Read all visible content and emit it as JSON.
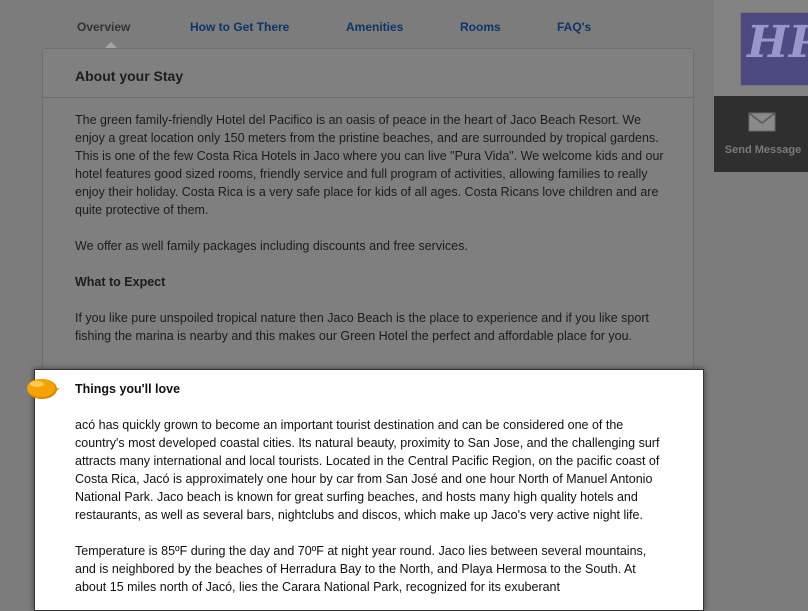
{
  "nav": {
    "tabs": [
      {
        "label": "Overview",
        "active": true
      },
      {
        "label": "How to Get There",
        "active": false
      },
      {
        "label": "Amenities",
        "active": false
      },
      {
        "label": "Rooms",
        "active": false
      },
      {
        "label": "FAQ's",
        "active": false
      }
    ]
  },
  "panel": {
    "title": "About your Stay",
    "intro": "The green family-friendly Hotel del Pacifico is an oasis of peace in the heart of Jaco Beach Resort. We enjoy a great location only 150 meters from the pristine beaches, and are surrounded by tropical gardens. This is one of the few Costa Rica Hotels in Jaco where you can live \"Pura Vida\". We welcome kids and our hotel features good sized rooms, friendly service and full program of activities, allowing families to really enjoy their holiday. Costa Rica is a very safe place for kids of all ages. Costa Ricans love children and are quite protective of them.",
    "packages": "We offer as well family packages including discounts and free services.",
    "expect_heading": "What to Expect",
    "expect_text": "If you like pure unspoiled tropical nature then Jaco Beach is the place to experience and if you like sport fishing the marina is nearby and this makes our Green Hotel the perfect and affordable place for you."
  },
  "highlight": {
    "heading": "Things you'll love",
    "para1": "acó has quickly grown to become an important tourist destination and can be considered one of the country's most developed coastal cities. Its natural beauty, proximity to San Jose, and the challenging surf attracts many international and local tourists. Located in the Central Pacific Region, on the pacific coast of Costa Rica, Jacó is approximately one hour by car from San José and one hour North of Manuel Antonio National Park. Jaco beach is known for great surfing beaches, and hosts many high quality hotels and restaurants, as well as several bars, nightclubs and discos, which make up Jaco's very active night life.",
    "para2": "Temperature is 85ºF during the day and 70ºF at night year round. Jaco lies between several mountains, and is neighbored by the beaches of Herradura Bay to the North, and Playa Hermosa to the South. At about 15 miles north of Jacó, lies the Carara National Park, recognized for its exuberant"
  },
  "sidebar": {
    "logo_text": "HP",
    "send_message": "Send Message",
    "icons": {
      "envelope": "envelope-icon",
      "pointer": "callout-pointer-icon"
    }
  },
  "colors": {
    "nav_link": "#0e3569",
    "overlay": "#7c7c7c",
    "pointer": "#f5a300",
    "logo_bg": "#4d4a82"
  }
}
